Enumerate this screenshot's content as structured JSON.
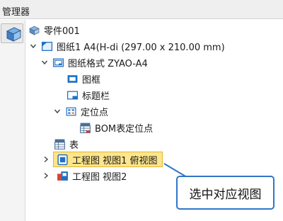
{
  "window": {
    "title": "管理器"
  },
  "tree": {
    "part": {
      "label": "零件001",
      "icon": "part-icon"
    },
    "sheet": {
      "label": "图纸1 A4(H-di (297.00 x 210.00 mm)",
      "icon": "sheet-icon",
      "expanded": true
    },
    "sheet_format": {
      "label": "图纸格式 ZYAO-A4",
      "icon": "sheet-format-icon",
      "expanded": true
    },
    "frame": {
      "label": "图框",
      "icon": "frame-icon"
    },
    "title_block": {
      "label": "标题栏",
      "icon": "title-block-icon"
    },
    "anchors": {
      "label": "定位点",
      "icon": "anchor-folder-icon",
      "expanded": true
    },
    "bom_anchor": {
      "label": "BOM表定位点",
      "icon": "bom-icon"
    },
    "table": {
      "label": "表",
      "icon": "table-icon"
    },
    "view1": {
      "label": "工程图 视图1 俯视图",
      "icon": "drawing-view-icon",
      "expanded": false,
      "selected": true
    },
    "view2": {
      "label": "工程图 视图2",
      "icon": "drawing-view-icon",
      "expanded": false
    }
  },
  "callout": {
    "text": "选中对应视图",
    "border_color": "#2f76c8"
  },
  "colors": {
    "selection_bg": "#fde58c",
    "selection_border": "#e3b631",
    "icon_blue": "#1f6fc5"
  }
}
